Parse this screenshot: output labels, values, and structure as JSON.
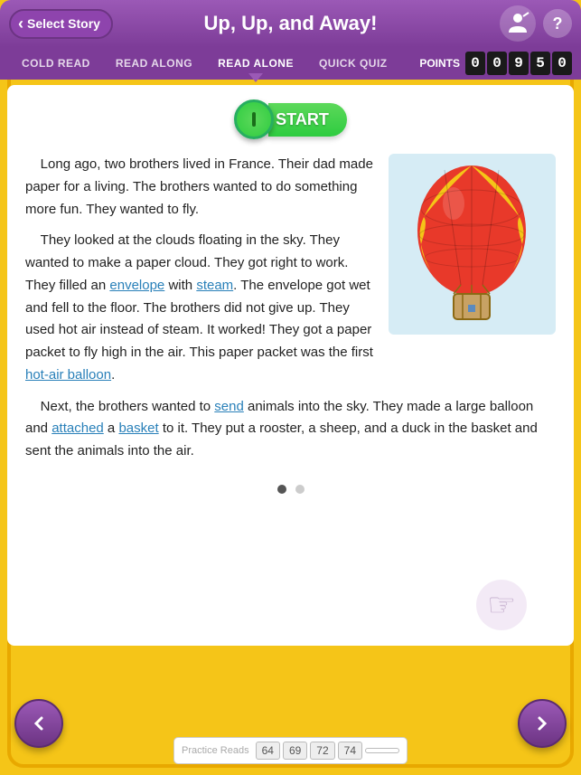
{
  "header": {
    "back_label": "Select Story",
    "title": "Up, Up, and Away!",
    "help_label": "?"
  },
  "nav": {
    "tabs": [
      {
        "label": "COLD READ",
        "active": false
      },
      {
        "label": "READ ALONG",
        "active": false
      },
      {
        "label": "READ ALONE",
        "active": true
      },
      {
        "label": "QUICK QUIZ",
        "active": false
      }
    ],
    "points_label": "POINTS",
    "points_digits": [
      "0",
      "0",
      "9",
      "5",
      "0"
    ]
  },
  "start_button": {
    "label": "START"
  },
  "story": {
    "paragraph1": "Long ago, two brothers lived in France. Their dad made paper for a living. The brothers wanted to do something more fun. They wanted to fly.",
    "paragraph2": "They looked at the clouds floating in the sky. They wanted to make a paper cloud. They got right to work. They filled an",
    "vocab1": "envelope",
    "paragraph2b": "with",
    "vocab2": "steam",
    "paragraph2c": ". The envelope got wet and fell to the floor. The brothers did not give up. They used hot air instead of steam. It worked! They got a paper packet to fly high in the air. This paper packet was the first",
    "vocab3": "hot-air balloon",
    "paragraph2d": ".",
    "paragraph3": "Next, the brothers wanted to",
    "vocab4": "send",
    "paragraph3b": "animals into the sky. They made a large balloon and",
    "vocab5": "attached",
    "paragraph3c": "a",
    "vocab6": "basket",
    "paragraph3d": "to it. They put a rooster, a sheep, and a duck in the basket and sent the animals into the air."
  },
  "pagination": {
    "current": 1,
    "total": 2
  },
  "practice_reads": {
    "label": "Practice Reads",
    "scores": [
      "64",
      "69",
      "72",
      "74",
      ""
    ]
  },
  "nav_arrows": {
    "left": "‹",
    "right": "›"
  }
}
